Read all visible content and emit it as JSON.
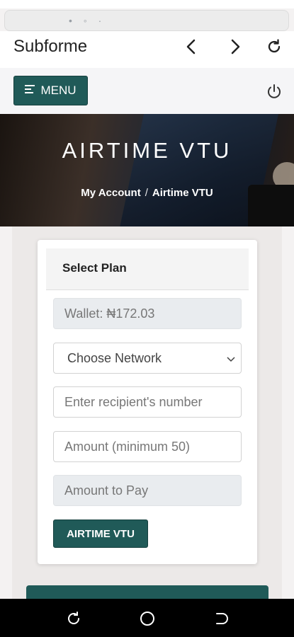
{
  "browser": {
    "app_title": "Subforme"
  },
  "header": {
    "menu_label": "MENU"
  },
  "banner": {
    "title": "AIRTIME VTU",
    "breadcrumb": [
      "My Account",
      "Airtime VTU"
    ]
  },
  "form": {
    "card_title": "Select Plan",
    "wallet_placeholder": "Wallet: ₦172.03",
    "network_select": "Choose Network",
    "recipient_placeholder": "Enter recipient's number",
    "amount_placeholder": "Amount (minimum 50)",
    "amount_to_pay_placeholder": "Amount to Pay",
    "submit_label": "AIRTIME VTU"
  },
  "colors": {
    "primary": "#205a58",
    "page_bg": "#f4f2f2",
    "readonly_bg": "#e9ecef"
  },
  "icons": [
    "back-arrow-icon",
    "forward-arrow-icon",
    "reload-icon",
    "hamburger-icon",
    "power-icon",
    "recent-apps-icon",
    "home-icon",
    "back-icon"
  ]
}
